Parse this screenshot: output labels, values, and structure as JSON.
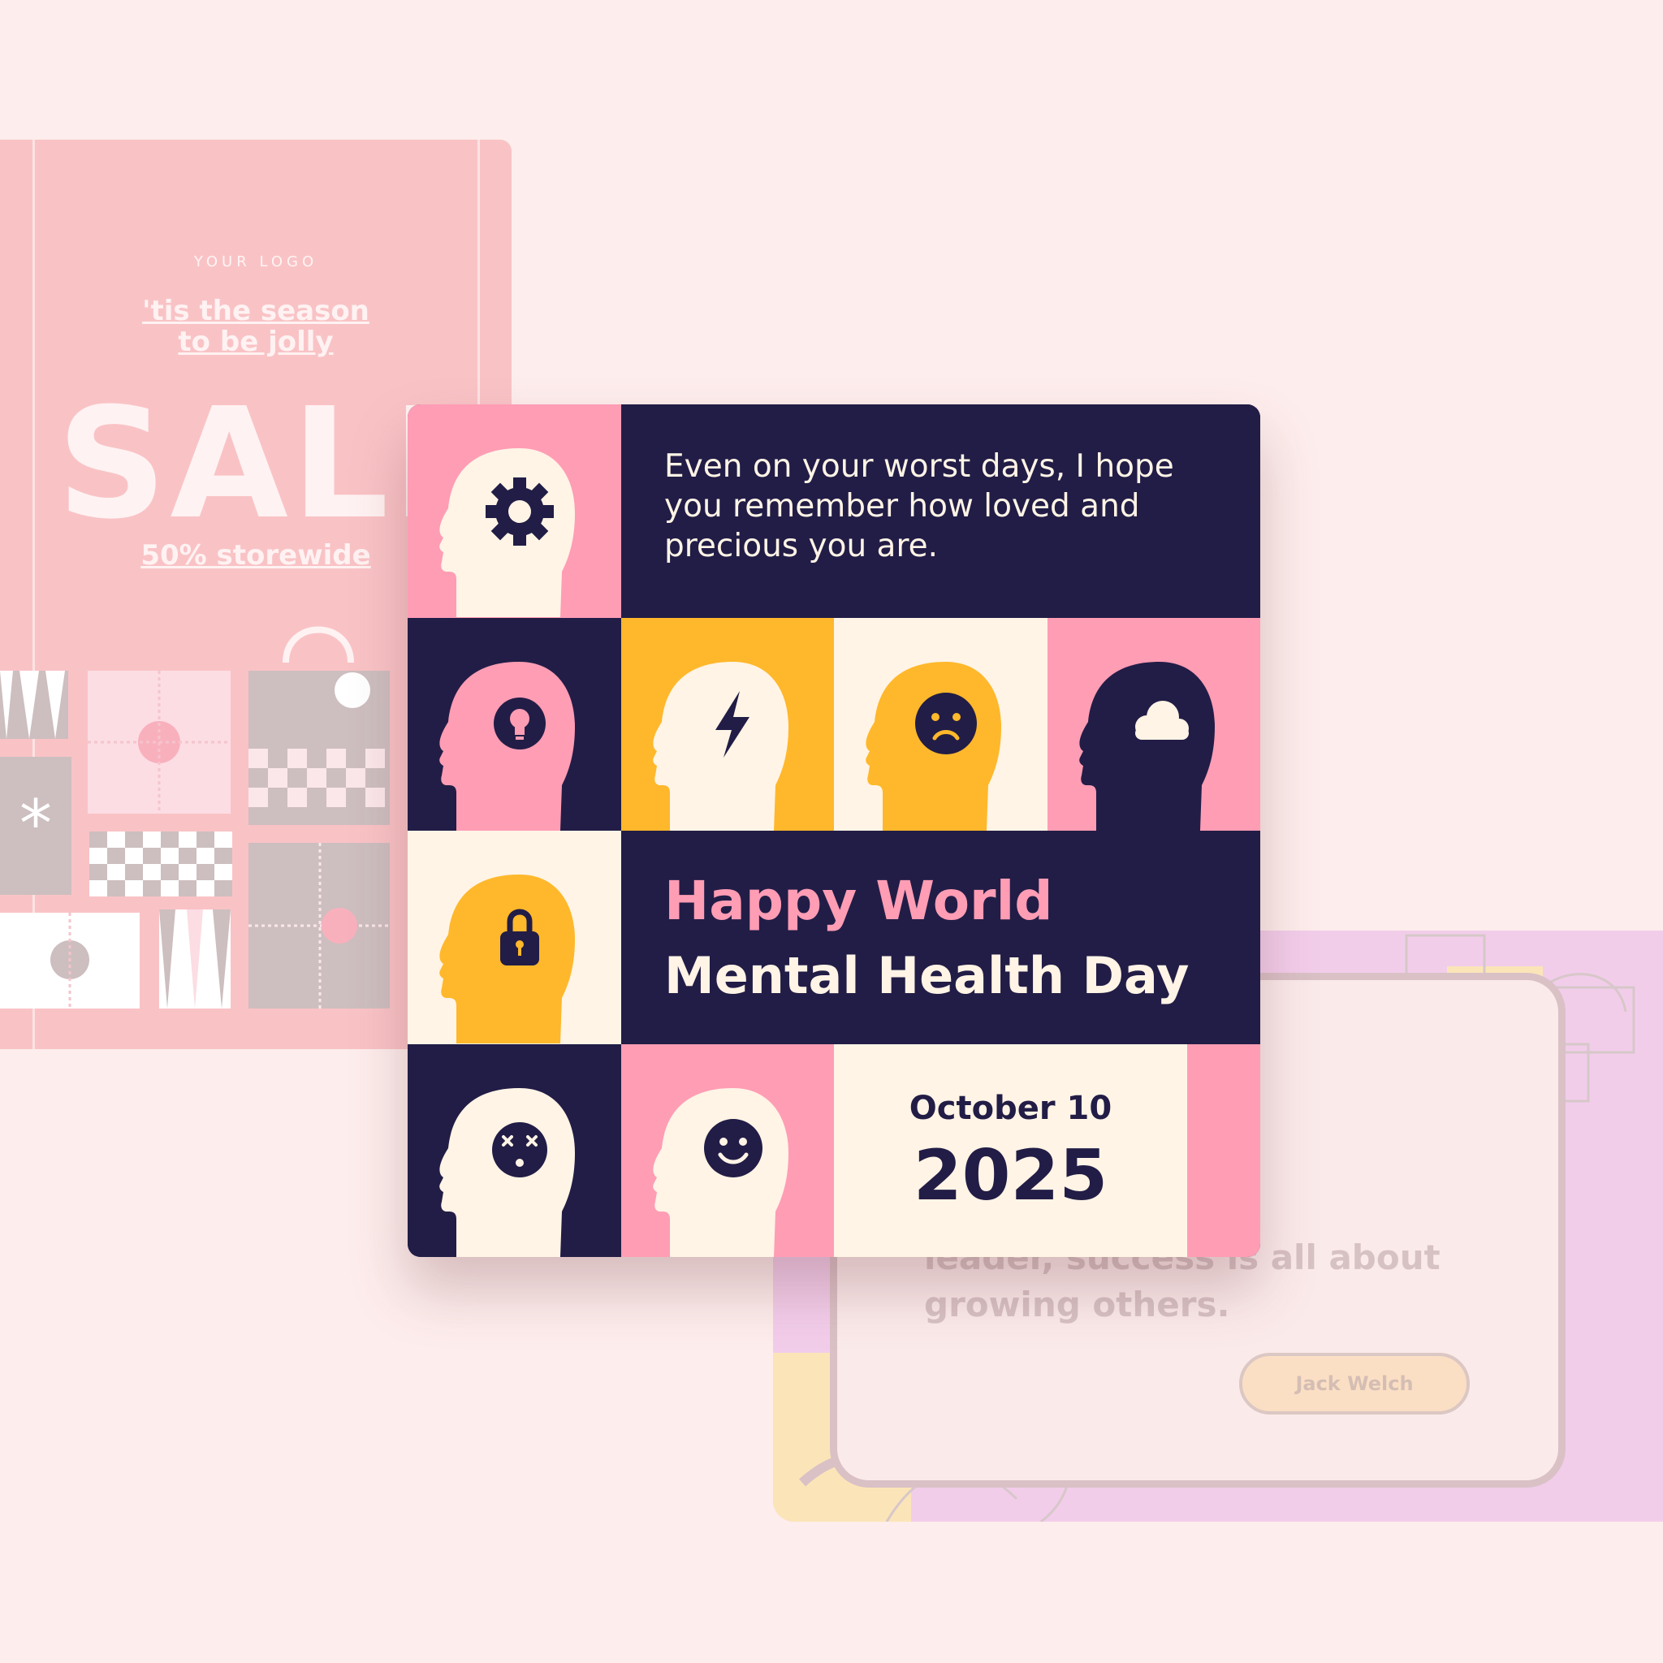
{
  "colors": {
    "page_background": "#FDEDEC",
    "navy": "#221D46",
    "pink": "#FF9DB5",
    "yellow": "#FFB82B",
    "cream": "#FFF4E6"
  },
  "sale_card": {
    "logo_text": "YOUR LOGO",
    "tagline": "'tis the season\nto be jolly",
    "headline": "SALE",
    "discount": "50% storewide"
  },
  "featured_card": {
    "quote": "Even on your worst days, I hope you remember how loved and precious you are.",
    "title_line1": "Happy World",
    "title_line2": "Mental Health Day",
    "date_month_day": "October 10",
    "date_year": "2025",
    "icons": [
      "gear-icon",
      "lightbulb-icon",
      "lightning-icon",
      "sad-face-icon",
      "cloud-icon",
      "padlock-icon",
      "dizzy-face-icon",
      "smiley-face-icon"
    ]
  },
  "quote_card": {
    "quote_visible": "a leader,\nbout growing\nou become a\nleader, success is all about\ngrowing others.",
    "author": "Jack Welch"
  }
}
